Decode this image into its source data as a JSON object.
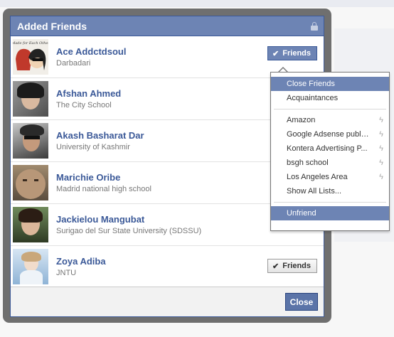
{
  "dialog": {
    "title": "Added Friends",
    "close_label": "Close"
  },
  "friends": [
    {
      "name": "Ace Addctdsoul",
      "sub": "Darbadari",
      "button": "Friends",
      "button_active": true,
      "avatar_text": "Made for Each Other"
    },
    {
      "name": "Afshan Ahmed",
      "sub": "The City School"
    },
    {
      "name": "Akash Basharat Dar",
      "sub": "University of Kashmir"
    },
    {
      "name": "Marichie Oribe",
      "sub": "Madrid national high school"
    },
    {
      "name": "Jackielou Mangubat",
      "sub": "Surigao del Sur State University (SDSSU)"
    },
    {
      "name": "Zoya Adiba",
      "sub": "JNTU",
      "button": "Friends",
      "button_active": false
    }
  ],
  "menu": {
    "items_top": [
      "Close Friends",
      "Acquaintances"
    ],
    "lists": [
      "Amazon",
      "Google Adsense publis...",
      "Kontera Advertising P...",
      "bsgh school",
      "Los Angeles Area"
    ],
    "show_all": "Show All Lists...",
    "unfriend": "Unfriend"
  },
  "colors": {
    "header": "#6d84b4",
    "link": "#3b5998",
    "highlight": "#6d84b4"
  },
  "icons": [
    "lock-icon",
    "check-icon",
    "bolt-icon"
  ]
}
